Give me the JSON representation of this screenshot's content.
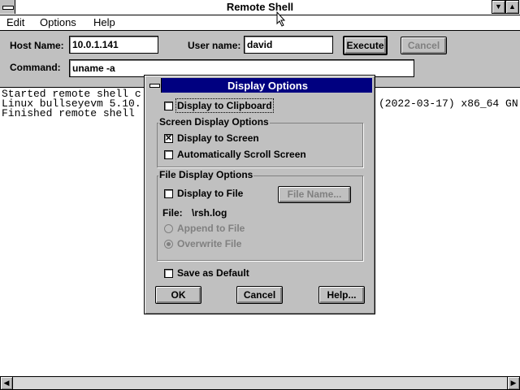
{
  "window": {
    "title": "Remote Shell"
  },
  "menu": {
    "items": [
      "Edit",
      "Options",
      "Help"
    ]
  },
  "form": {
    "host_label": "Host Name:",
    "host_value": "10.0.1.141",
    "user_label": "User name:",
    "user_value": "david",
    "command_label": "Command:",
    "command_value": "uname -a",
    "execute_label": "Execute",
    "cancel_label": "Cancel"
  },
  "output": {
    "lines": [
      "Started remote shell c",
      "Linux bullseyevm 5.10.",
      "Finished remote shell"
    ],
    "line2_tail": "(2022-03-17) x86_64 GN"
  },
  "dialog": {
    "title": "Display Options",
    "clipboard_label": "Display to Clipboard",
    "clipboard_checked": false,
    "screen_group_title": "Screen Display Options",
    "screen_label": "Display to Screen",
    "screen_checked": true,
    "autoscroll_label": "Automatically Scroll Screen",
    "autoscroll_checked": false,
    "file_group_title": "File Display Options",
    "file_label": "Display to File",
    "file_checked": false,
    "filename_button": "File Name...",
    "file_caption": "File:",
    "file_path": "\\rsh.log",
    "append_label": "Append to File",
    "overwrite_label": "Overwrite File",
    "overwrite_selected": true,
    "default_label": "Save as Default",
    "default_checked": false,
    "ok_label": "OK",
    "cancel_label": "Cancel",
    "help_label": "Help..."
  },
  "icons": {
    "system_menu": "system-menu-icon",
    "minimize": "triangle-down",
    "maximize": "triangle-up",
    "scroll_left": "triangle-left",
    "scroll_right": "triangle-right"
  }
}
